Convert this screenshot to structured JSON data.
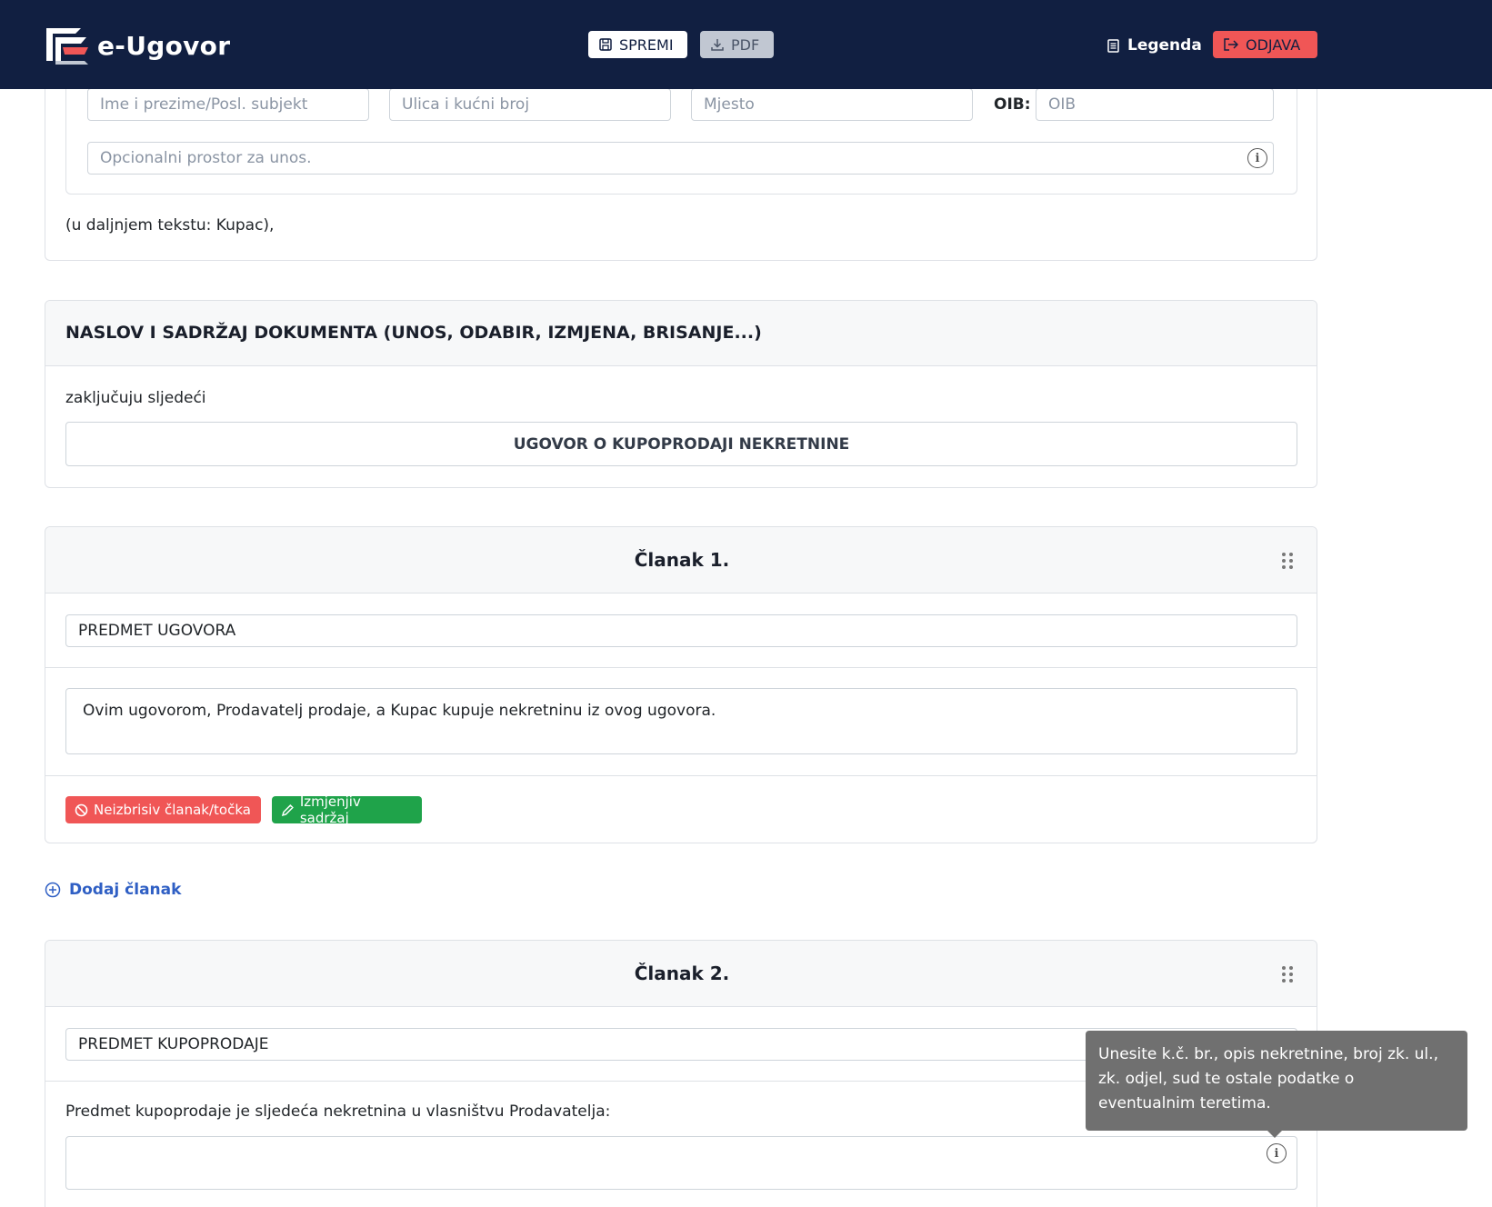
{
  "brand": {
    "name": "e-Ugovor"
  },
  "toolbar": {
    "save_label": "SPREMI",
    "pdf_label": "PDF",
    "legend_label": "Legenda",
    "logout_label": "ODJAVA"
  },
  "buyer_section": {
    "name_placeholder": "Ime i prezime/Posl. subjekt",
    "street_placeholder": "Ulica i kućni broj",
    "place_placeholder": "Mjesto",
    "oib_label": "OIB:",
    "oib_placeholder": "OIB",
    "optional_placeholder": "Opcionalni prostor za unos.",
    "footer_text": "(u daljnjem tekstu: Kupac),"
  },
  "title_section": {
    "header": "NASLOV I SADRŽAJ DOKUMENTA (UNOS, ODABIR, IZMJENA, BRISANJE...)",
    "intro": "zaključuju sljedeći",
    "title_value": "UGOVOR O KUPOPRODAJI NEKRETNINE"
  },
  "article1": {
    "header": "Članak 1.",
    "subject_value": "PREDMET UGOVORA",
    "body_value": "Ovim ugovorom, Prodavatelj prodaje, a Kupac kupuje nekretninu iz ovog ugovora.",
    "badge_non_deletable": "Neizbrisiv članak/točka",
    "badge_editable": "Izmjenjiv sadržaj"
  },
  "add_article_label": "Dodaj članak",
  "article2": {
    "header": "Članak 2.",
    "subject_value": "PREDMET KUPOPRODAJE",
    "intro": "Predmet kupoprodaje je sljedeća nekretnina u vlasništvu Prodavatelja:",
    "body_value": ""
  },
  "tooltip": {
    "text": "Unesite k.č. br., opis nekretnine, broj zk. ul., zk. odjel, sud te ostale podatke o eventualnim teretima."
  },
  "colors": {
    "navbar": "#111f41",
    "danger": "#f05656",
    "success": "#1fa34a",
    "link": "#2f5fc4"
  }
}
